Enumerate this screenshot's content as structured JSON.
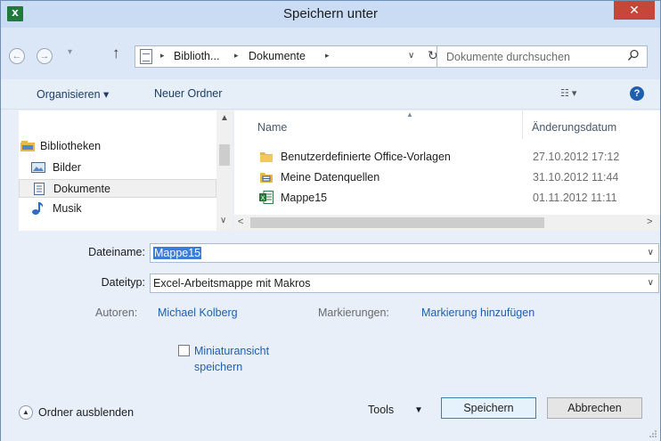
{
  "window": {
    "title": "Speichern unter",
    "app_icon": "X",
    "close_glyph": "✕"
  },
  "nav": {
    "back": "←",
    "forward": "→",
    "up": "↑",
    "breadcrumbs": [
      "Biblioth...",
      "Dokumente"
    ],
    "refresh": "↻",
    "search_placeholder": "Dokumente durchsuchen"
  },
  "toolbar": {
    "organize": "Organisieren ▾",
    "new_folder": "Neuer Ordner",
    "view": "☷ ▾",
    "help": "?"
  },
  "navpane": {
    "group": "Bibliotheken",
    "items": [
      {
        "label": "Bilder",
        "icon": "pictures-icon"
      },
      {
        "label": "Dokumente",
        "icon": "document-icon",
        "selected": true
      },
      {
        "label": "Musik",
        "icon": "music-icon"
      }
    ]
  },
  "filelist": {
    "columns": {
      "name": "Name",
      "date": "Änderungsdatum"
    },
    "rows": [
      {
        "name": "Benutzerdefinierte Office-Vorlagen",
        "date": "27.10.2012 17:12",
        "icon": "folder-icon"
      },
      {
        "name": "Meine Datenquellen",
        "date": "31.10.2012 11:44",
        "icon": "datasource-folder-icon"
      },
      {
        "name": "Mappe15",
        "date": "01.11.2012 11:11",
        "icon": "excel-file-icon"
      }
    ]
  },
  "form": {
    "filename_label": "Dateiname:",
    "filename_value": "Mappe15",
    "filetype_label": "Dateityp:",
    "filetype_value": "Excel-Arbeitsmappe mit Makros",
    "authors_label": "Autoren:",
    "authors_value": "Michael Kolberg",
    "tags_label": "Markierungen:",
    "tags_value": "Markierung hinzufügen",
    "thumbnail_line1": "Miniaturansicht",
    "thumbnail_line2": "speichern"
  },
  "footer": {
    "hide_folders": "Ordner ausblenden",
    "tools": "Tools",
    "save": "Speichern",
    "cancel": "Abbrechen"
  }
}
